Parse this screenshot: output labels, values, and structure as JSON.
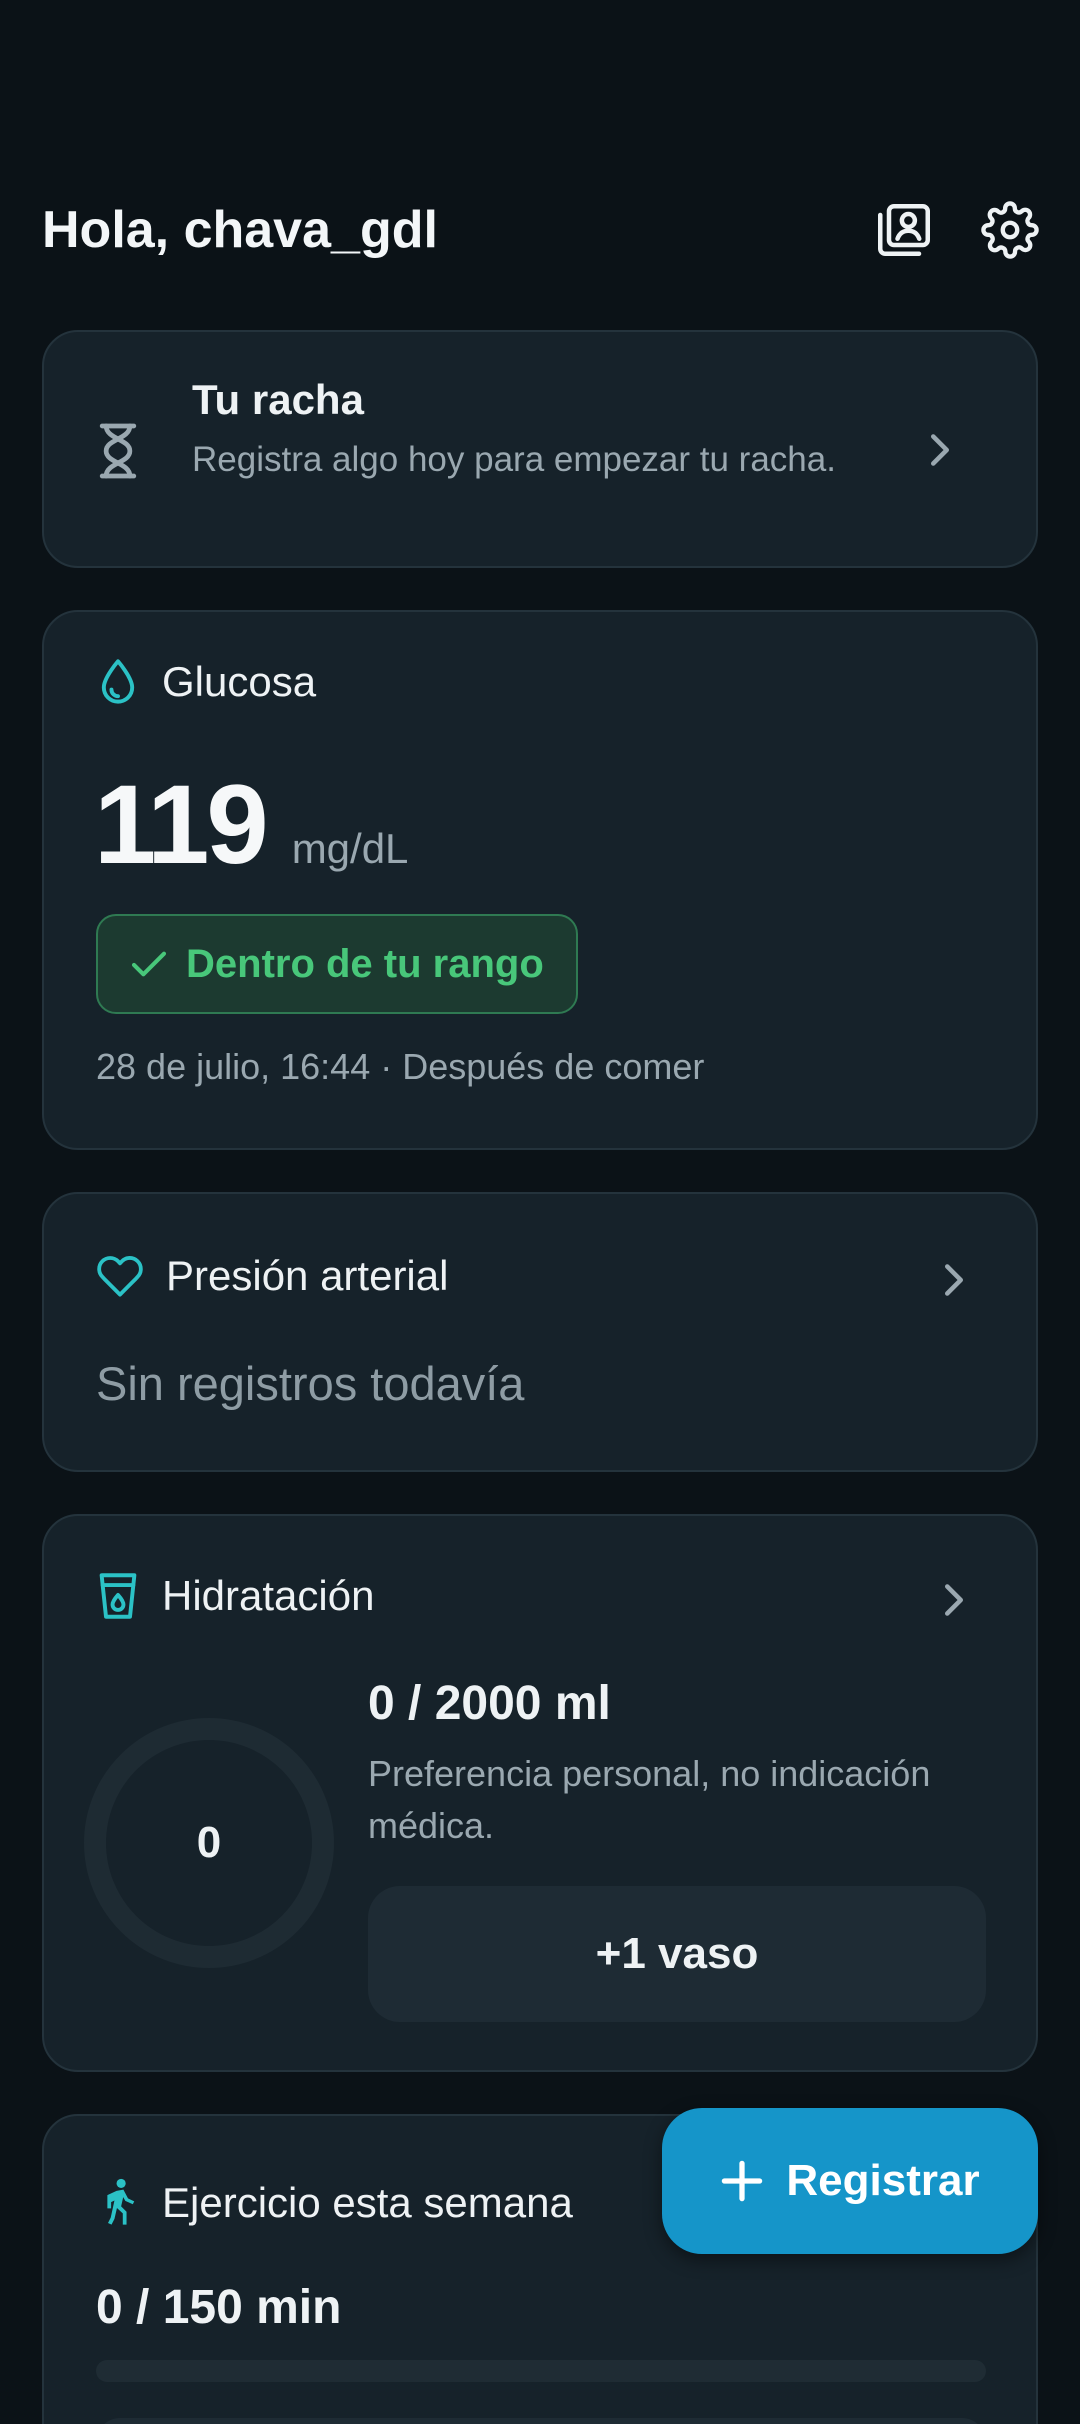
{
  "header": {
    "greeting": "Hola, chava_gdl",
    "profile_icon": "profile-card-icon",
    "settings_icon": "gear-icon"
  },
  "streak": {
    "title": "Tu racha",
    "subtitle": "Registra algo hoy para empezar tu racha.",
    "icon": "hourglass-icon"
  },
  "glucose": {
    "title": "Glucosa",
    "icon": "droplet-icon",
    "value": "119",
    "unit": "mg/dL",
    "status": "Dentro de tu rango",
    "meta": "28 de julio, 16:44 · Después de comer"
  },
  "blood_pressure": {
    "title": "Presión arterial",
    "icon": "heart-icon",
    "empty": "Sin registros todavía"
  },
  "hydration": {
    "title": "Hidratación",
    "icon": "water-glass-icon",
    "count": "0",
    "amount": "0 / 2000 ml",
    "note": "Preferencia personal, no indicación médica.",
    "add_label": "+1 vaso",
    "progress": 0
  },
  "exercise": {
    "title": "Ejercicio esta semana",
    "icon": "walking-icon",
    "amount": "0 / 150 min",
    "progress": 0
  },
  "fab": {
    "label": "Registrar",
    "icon": "plus-icon"
  },
  "colors": {
    "background": "#0b1217",
    "card": "#16222a",
    "accent": "#2bc2c6",
    "success": "#48c77a",
    "fab": "#1595c9"
  }
}
